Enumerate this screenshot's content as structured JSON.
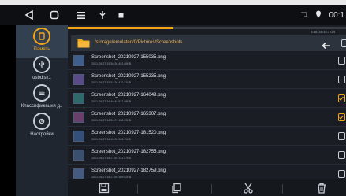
{
  "status_bar": {
    "time": "00:1"
  },
  "sidebar": {
    "items": [
      {
        "label": "Память",
        "icon": "storage-icon",
        "active": true
      },
      {
        "label": "usbdisk1",
        "icon": "usb-icon",
        "active": false
      },
      {
        "label": "Классификация д..",
        "icon": "list-icon",
        "active": false
      },
      {
        "label": "Настройки",
        "icon": "gear-icon",
        "active": false
      }
    ]
  },
  "storage": {
    "usage_text": "6.58 GB/16.3 GB",
    "used_fraction": 0.38
  },
  "path": {
    "text": "/storage/emulated/0/Pictures/Screenshots"
  },
  "files": [
    {
      "name": "Screenshot_20210927-155035.png",
      "meta": "2021-09-27 15:50:36  491.05KB",
      "checked": false
    },
    {
      "name": "Screenshot_20210927-155235.png",
      "meta": "2021-09-27 15:52:36  470.21KB",
      "checked": false
    },
    {
      "name": "Screenshot_20210927-164049.png",
      "meta": "2021-09-27 16:40:49  512.88KB",
      "checked": true
    },
    {
      "name": "Screenshot_20210927-165307.png",
      "meta": "2021-09-27 16:53:07  498.23KB",
      "checked": true
    },
    {
      "name": "Screenshot_20210927-181520.png",
      "meta": "2021-09-27 18:15:20  305.11KB",
      "checked": false
    },
    {
      "name": "Screenshot_20210927-182755.png",
      "meta": "2021-09-27 18:27:55  311.47KB",
      "checked": false
    },
    {
      "name": "Screenshot_20210927-182759.png",
      "meta": "2021-09-27 18:27:59  309.62KB",
      "checked": false
    }
  ],
  "colors": {
    "accent": "#f0a419",
    "sidebar_bg": "#20262f",
    "main_bg": "#1a1e24"
  }
}
